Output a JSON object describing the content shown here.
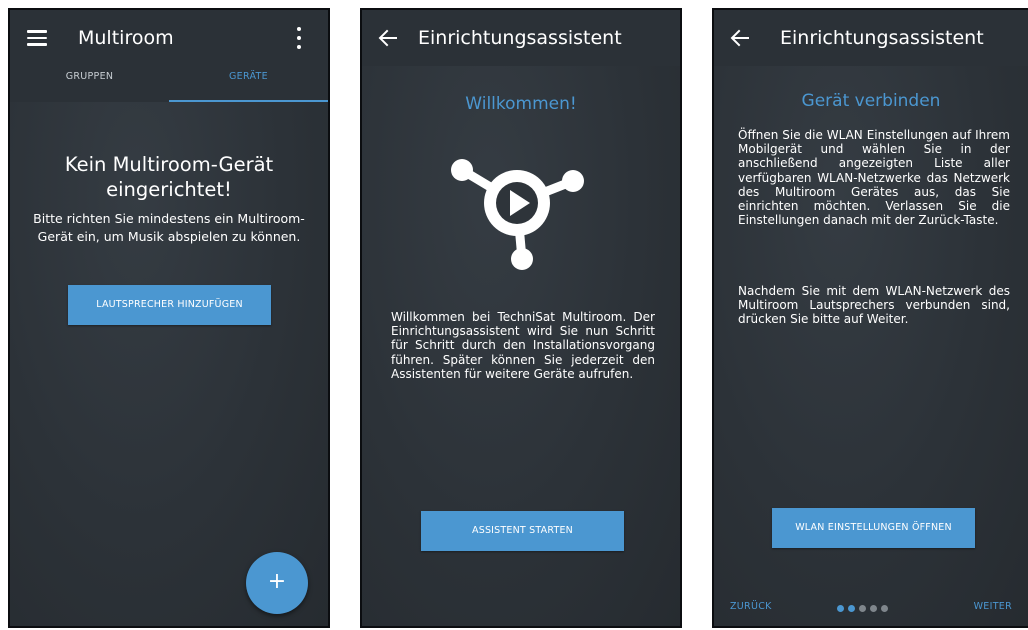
{
  "screens": {
    "multiroom": {
      "title": "Multiroom",
      "tabs": [
        {
          "label": "GRUPPEN",
          "active": false
        },
        {
          "label": "GERÄTE",
          "active": true
        }
      ],
      "empty_title": "Kein Multiroom-Gerät eingerichtet!",
      "empty_description": "Bitte richten Sie mindestens ein Multiroom-Gerät ein, um Musik abspielen zu können.",
      "add_speaker_button": "LAUTSPRECHER HINZUFÜGEN",
      "fab_label": "+",
      "icons": [
        "menu-icon",
        "more-vert-icon"
      ]
    },
    "welcome": {
      "title": "Einrichtungsassistent",
      "heading": "Willkommen!",
      "text": "Willkommen bei TechniSat Multiroom. Der Einrichtungsassistent wird Sie nun Schritt für Schritt durch den Installationsvorgang führen. Später können Sie jederzeit den Assistenten für weitere Geräte aufrufen.",
      "start_button": "ASSISTENT STARTEN",
      "icons": [
        "back-arrow-icon",
        "multiroom-logo-icon"
      ]
    },
    "connect": {
      "title": "Einrichtungsassistent",
      "heading": "Gerät verbinden",
      "text_1": "Öffnen Sie die WLAN Einstellungen auf Ihrem Mobilgerät und wählen Sie in der anschließend angezeigten Liste aller verfügbaren WLAN-Netzwerke das Netzwerk des Multiroom Gerätes aus, das Sie einrichten möchten. Verlassen Sie die Einstellungen danach mit der Zurück-Taste.",
      "text_2": "Nachdem Sie mit dem WLAN-Netzwerk des Multiroom Lautsprechers verbunden sind, drücken Sie bitte auf Weiter.",
      "wlan_button": "WLAN EINSTELLUNGEN ÖFFNEN",
      "back_link": "ZURÜCK",
      "next_link": "WEITER",
      "progress": {
        "total_steps": 5,
        "current_step": 2
      }
    }
  },
  "colors": {
    "accent": "#4b97d1",
    "background": "#2f353b",
    "appbar": "#2b3137",
    "dot_inactive": "#7f868c"
  }
}
